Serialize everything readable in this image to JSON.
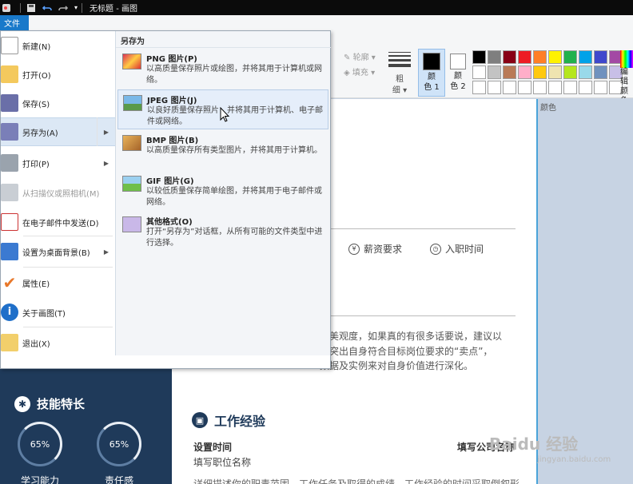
{
  "titlebar": {
    "title": "无标题 - 画图"
  },
  "file_tab": "文件",
  "ribbon": {
    "outline": "轮廓",
    "fill": "填充",
    "size_label": "粗\n细",
    "color1": "颜\n色 1",
    "color2": "颜\n色 2",
    "colors_group": "颜色",
    "edit_colors": "编辑\n颜色",
    "palette": [
      "#000000",
      "#7f7f7f",
      "#880015",
      "#ed1c24",
      "#ff7f27",
      "#fff200",
      "#22b14c",
      "#00a2e8",
      "#3f48cc",
      "#a349a4",
      "#ffffff",
      "#c3c3c3",
      "#b97a57",
      "#ffaec9",
      "#ffc90e",
      "#efe4b0",
      "#b5e61d",
      "#99d9ea",
      "#7092be",
      "#c8bfe7",
      "#ffffff",
      "#ffffff",
      "#ffffff",
      "#ffffff",
      "#ffffff",
      "#ffffff",
      "#ffffff",
      "#ffffff",
      "#ffffff",
      "#ffffff"
    ]
  },
  "file_menu": {
    "items": [
      {
        "label": "新建(N)",
        "icon": "new-file-icon"
      },
      {
        "label": "打开(O)",
        "icon": "open-folder-icon"
      },
      {
        "label": "保存(S)",
        "icon": "save-icon"
      },
      {
        "label": "另存为(A)",
        "icon": "save-as-icon"
      },
      {
        "label": "打印(P)",
        "icon": "printer-icon"
      },
      {
        "label": "从扫描仪或照相机(M)",
        "icon": "scanner-icon"
      },
      {
        "label": "在电子邮件中发送(D)",
        "icon": "email-icon"
      },
      {
        "label": "设置为桌面背景(B)",
        "icon": "desktop-icon"
      },
      {
        "label": "属性(E)",
        "icon": "checkmark-icon"
      },
      {
        "label": "关于画图(T)",
        "icon": "info-icon"
      },
      {
        "label": "退出(X)",
        "icon": "exit-icon"
      }
    ]
  },
  "save_as": {
    "header": "另存为",
    "items": [
      {
        "title": "PNG 图片(P)",
        "desc": "以高质量保存照片或绘图，并将其用于计算机或网络。"
      },
      {
        "title": "JPEG 图片(J)",
        "desc": "以良好质量保存照片，并将其用于计算机、电子邮件或网络。"
      },
      {
        "title": "BMP 图片(B)",
        "desc": "以高质量保存所有类型图片，并将其用于计算机。"
      },
      {
        "title": "GIF 图片(G)",
        "desc": "以较低质量保存简单绘图，并将其用于电子邮件或网络。"
      },
      {
        "title": "其他格式(O)",
        "desc": "打开“另存为”对话框，从所有可能的文件类型中进行选择。"
      }
    ]
  },
  "resume": {
    "salary": "薪资要求",
    "entry_time": "入职时间",
    "para_lines": [
      "的美观度，如果真的有很多话要说，建议以",
      "到突出自身符合目标岗位要求的“卖点”，",
      "数据及实例来对自身价值进行深化。"
    ],
    "skills_title": "技能特长",
    "skill1_pct": "65%",
    "skill1_label": "学习能力",
    "skill2_pct": "65%",
    "skill2_label": "责任感",
    "work_title": "工作经验",
    "set_time": "设置时间",
    "company": "填写公司名称",
    "position": "填写职位名称",
    "desc": "详细描述你的职责范围、工作任务及取得的成绩，工作经验的时间采取倒叙形"
  },
  "watermark": {
    "main": "Baidu 经验",
    "sub": "jingyan.baidu.com"
  }
}
